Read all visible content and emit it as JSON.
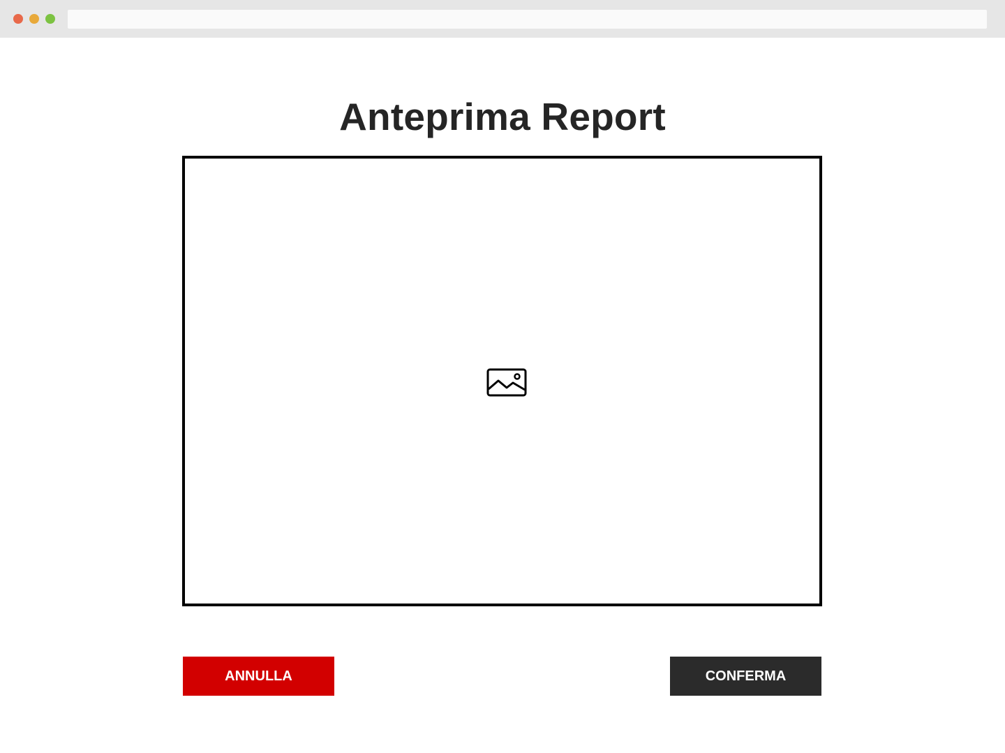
{
  "page": {
    "title": "Anteprima Report"
  },
  "preview": {
    "placeholder_icon": "image-icon"
  },
  "actions": {
    "cancel_label": "ANNULLA",
    "confirm_label": "CONFERMA"
  },
  "colors": {
    "cancel": "#d20000",
    "confirm": "#2b2b2b",
    "title": "#252525",
    "frame_border": "#000000",
    "chrome": "#e6e6e6"
  }
}
